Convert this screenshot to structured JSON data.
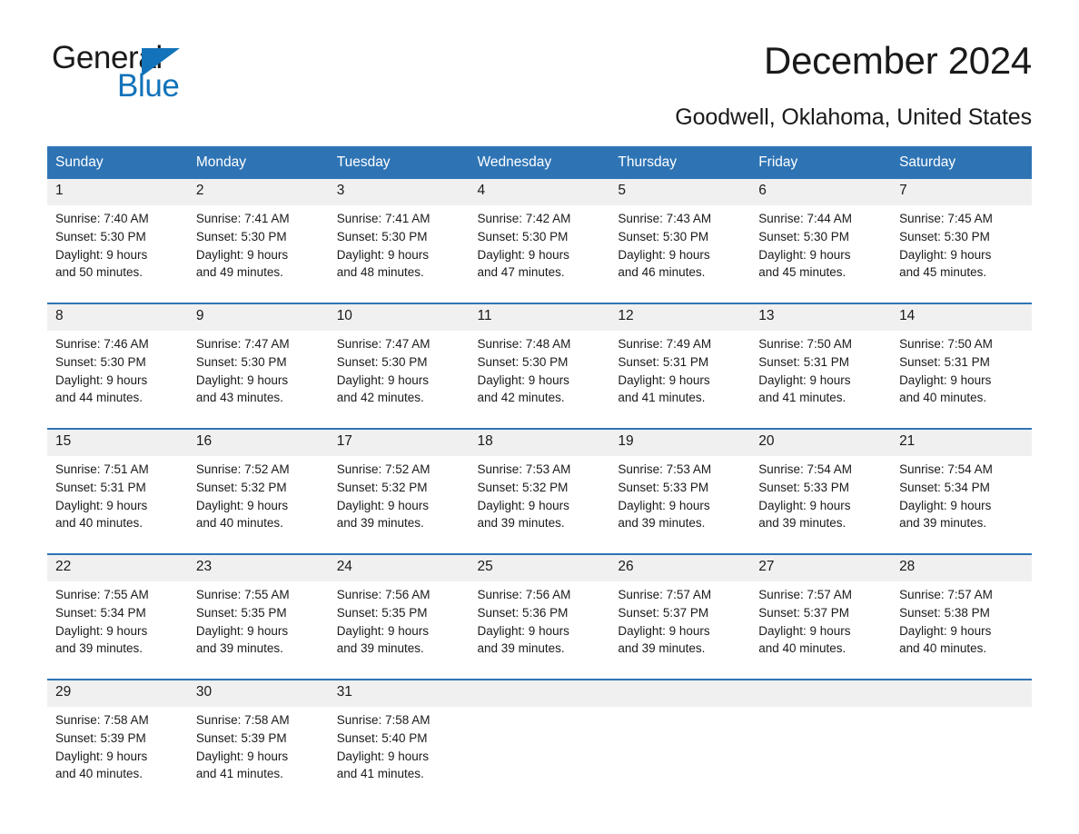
{
  "brand": {
    "name_part1": "General",
    "name_part2": "Blue"
  },
  "header": {
    "title": "December 2024",
    "location": "Goodwell, Oklahoma, United States"
  },
  "colors": {
    "header_blue": "#2e74b5",
    "brand_blue": "#1273ba",
    "daynum_band": "#f0f0f0",
    "text": "#1a1a1a"
  },
  "weekdays": [
    "Sunday",
    "Monday",
    "Tuesday",
    "Wednesday",
    "Thursday",
    "Friday",
    "Saturday"
  ],
  "weeks": [
    [
      {
        "day": "1",
        "sunrise": "Sunrise: 7:40 AM",
        "sunset": "Sunset: 5:30 PM",
        "daylight1": "Daylight: 9 hours",
        "daylight2": "and 50 minutes."
      },
      {
        "day": "2",
        "sunrise": "Sunrise: 7:41 AM",
        "sunset": "Sunset: 5:30 PM",
        "daylight1": "Daylight: 9 hours",
        "daylight2": "and 49 minutes."
      },
      {
        "day": "3",
        "sunrise": "Sunrise: 7:41 AM",
        "sunset": "Sunset: 5:30 PM",
        "daylight1": "Daylight: 9 hours",
        "daylight2": "and 48 minutes."
      },
      {
        "day": "4",
        "sunrise": "Sunrise: 7:42 AM",
        "sunset": "Sunset: 5:30 PM",
        "daylight1": "Daylight: 9 hours",
        "daylight2": "and 47 minutes."
      },
      {
        "day": "5",
        "sunrise": "Sunrise: 7:43 AM",
        "sunset": "Sunset: 5:30 PM",
        "daylight1": "Daylight: 9 hours",
        "daylight2": "and 46 minutes."
      },
      {
        "day": "6",
        "sunrise": "Sunrise: 7:44 AM",
        "sunset": "Sunset: 5:30 PM",
        "daylight1": "Daylight: 9 hours",
        "daylight2": "and 45 minutes."
      },
      {
        "day": "7",
        "sunrise": "Sunrise: 7:45 AM",
        "sunset": "Sunset: 5:30 PM",
        "daylight1": "Daylight: 9 hours",
        "daylight2": "and 45 minutes."
      }
    ],
    [
      {
        "day": "8",
        "sunrise": "Sunrise: 7:46 AM",
        "sunset": "Sunset: 5:30 PM",
        "daylight1": "Daylight: 9 hours",
        "daylight2": "and 44 minutes."
      },
      {
        "day": "9",
        "sunrise": "Sunrise: 7:47 AM",
        "sunset": "Sunset: 5:30 PM",
        "daylight1": "Daylight: 9 hours",
        "daylight2": "and 43 minutes."
      },
      {
        "day": "10",
        "sunrise": "Sunrise: 7:47 AM",
        "sunset": "Sunset: 5:30 PM",
        "daylight1": "Daylight: 9 hours",
        "daylight2": "and 42 minutes."
      },
      {
        "day": "11",
        "sunrise": "Sunrise: 7:48 AM",
        "sunset": "Sunset: 5:30 PM",
        "daylight1": "Daylight: 9 hours",
        "daylight2": "and 42 minutes."
      },
      {
        "day": "12",
        "sunrise": "Sunrise: 7:49 AM",
        "sunset": "Sunset: 5:31 PM",
        "daylight1": "Daylight: 9 hours",
        "daylight2": "and 41 minutes."
      },
      {
        "day": "13",
        "sunrise": "Sunrise: 7:50 AM",
        "sunset": "Sunset: 5:31 PM",
        "daylight1": "Daylight: 9 hours",
        "daylight2": "and 41 minutes."
      },
      {
        "day": "14",
        "sunrise": "Sunrise: 7:50 AM",
        "sunset": "Sunset: 5:31 PM",
        "daylight1": "Daylight: 9 hours",
        "daylight2": "and 40 minutes."
      }
    ],
    [
      {
        "day": "15",
        "sunrise": "Sunrise: 7:51 AM",
        "sunset": "Sunset: 5:31 PM",
        "daylight1": "Daylight: 9 hours",
        "daylight2": "and 40 minutes."
      },
      {
        "day": "16",
        "sunrise": "Sunrise: 7:52 AM",
        "sunset": "Sunset: 5:32 PM",
        "daylight1": "Daylight: 9 hours",
        "daylight2": "and 40 minutes."
      },
      {
        "day": "17",
        "sunrise": "Sunrise: 7:52 AM",
        "sunset": "Sunset: 5:32 PM",
        "daylight1": "Daylight: 9 hours",
        "daylight2": "and 39 minutes."
      },
      {
        "day": "18",
        "sunrise": "Sunrise: 7:53 AM",
        "sunset": "Sunset: 5:32 PM",
        "daylight1": "Daylight: 9 hours",
        "daylight2": "and 39 minutes."
      },
      {
        "day": "19",
        "sunrise": "Sunrise: 7:53 AM",
        "sunset": "Sunset: 5:33 PM",
        "daylight1": "Daylight: 9 hours",
        "daylight2": "and 39 minutes."
      },
      {
        "day": "20",
        "sunrise": "Sunrise: 7:54 AM",
        "sunset": "Sunset: 5:33 PM",
        "daylight1": "Daylight: 9 hours",
        "daylight2": "and 39 minutes."
      },
      {
        "day": "21",
        "sunrise": "Sunrise: 7:54 AM",
        "sunset": "Sunset: 5:34 PM",
        "daylight1": "Daylight: 9 hours",
        "daylight2": "and 39 minutes."
      }
    ],
    [
      {
        "day": "22",
        "sunrise": "Sunrise: 7:55 AM",
        "sunset": "Sunset: 5:34 PM",
        "daylight1": "Daylight: 9 hours",
        "daylight2": "and 39 minutes."
      },
      {
        "day": "23",
        "sunrise": "Sunrise: 7:55 AM",
        "sunset": "Sunset: 5:35 PM",
        "daylight1": "Daylight: 9 hours",
        "daylight2": "and 39 minutes."
      },
      {
        "day": "24",
        "sunrise": "Sunrise: 7:56 AM",
        "sunset": "Sunset: 5:35 PM",
        "daylight1": "Daylight: 9 hours",
        "daylight2": "and 39 minutes."
      },
      {
        "day": "25",
        "sunrise": "Sunrise: 7:56 AM",
        "sunset": "Sunset: 5:36 PM",
        "daylight1": "Daylight: 9 hours",
        "daylight2": "and 39 minutes."
      },
      {
        "day": "26",
        "sunrise": "Sunrise: 7:57 AM",
        "sunset": "Sunset: 5:37 PM",
        "daylight1": "Daylight: 9 hours",
        "daylight2": "and 39 minutes."
      },
      {
        "day": "27",
        "sunrise": "Sunrise: 7:57 AM",
        "sunset": "Sunset: 5:37 PM",
        "daylight1": "Daylight: 9 hours",
        "daylight2": "and 40 minutes."
      },
      {
        "day": "28",
        "sunrise": "Sunrise: 7:57 AM",
        "sunset": "Sunset: 5:38 PM",
        "daylight1": "Daylight: 9 hours",
        "daylight2": "and 40 minutes."
      }
    ],
    [
      {
        "day": "29",
        "sunrise": "Sunrise: 7:58 AM",
        "sunset": "Sunset: 5:39 PM",
        "daylight1": "Daylight: 9 hours",
        "daylight2": "and 40 minutes."
      },
      {
        "day": "30",
        "sunrise": "Sunrise: 7:58 AM",
        "sunset": "Sunset: 5:39 PM",
        "daylight1": "Daylight: 9 hours",
        "daylight2": "and 41 minutes."
      },
      {
        "day": "31",
        "sunrise": "Sunrise: 7:58 AM",
        "sunset": "Sunset: 5:40 PM",
        "daylight1": "Daylight: 9 hours",
        "daylight2": "and 41 minutes."
      },
      {
        "day": "",
        "sunrise": "",
        "sunset": "",
        "daylight1": "",
        "daylight2": ""
      },
      {
        "day": "",
        "sunrise": "",
        "sunset": "",
        "daylight1": "",
        "daylight2": ""
      },
      {
        "day": "",
        "sunrise": "",
        "sunset": "",
        "daylight1": "",
        "daylight2": ""
      },
      {
        "day": "",
        "sunrise": "",
        "sunset": "",
        "daylight1": "",
        "daylight2": ""
      }
    ]
  ]
}
